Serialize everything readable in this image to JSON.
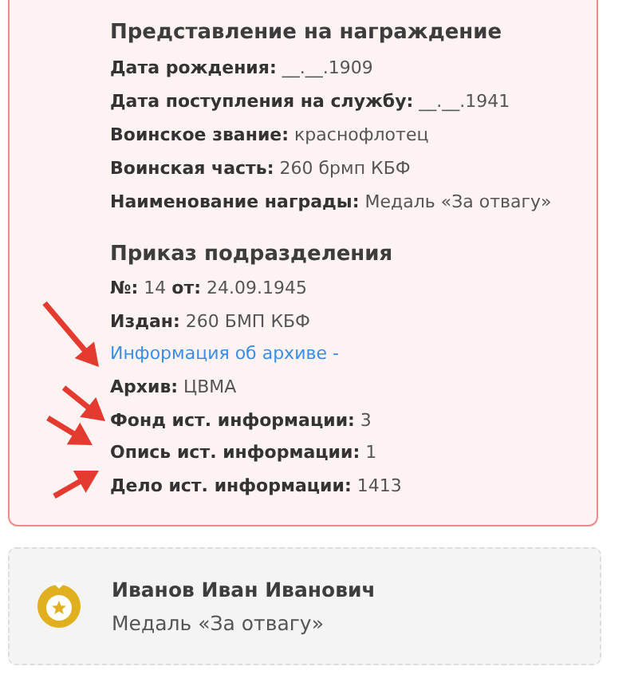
{
  "sections": [
    {
      "heading": "Представление на награждение",
      "rows": [
        {
          "kind": "text",
          "text": "**Дата рождения:** __.__.1909"
        },
        {
          "kind": "text",
          "text": "**Дата поступления на службу:** __.__.1941"
        },
        {
          "kind": "text",
          "text": "**Воинское звание:** краснофлотец"
        },
        {
          "kind": "text",
          "text": "**Воинская часть:** 260 брмп КБФ"
        },
        {
          "kind": "text",
          "text": "**Наименование награды:** Медаль «За отвагу»"
        }
      ]
    },
    {
      "heading": "Приказ подразделения",
      "rows": [
        {
          "kind": "text",
          "text": "**№:** 14 **от:** 24.09.1945"
        },
        {
          "kind": "text",
          "text": "**Издан:** 260 БМП КБФ"
        },
        {
          "kind": "link",
          "text": "Информация об архиве -"
        },
        {
          "kind": "text",
          "text": "**Архив:** ЦВМА"
        },
        {
          "kind": "text",
          "text": "**Фонд ист. информации:** 3"
        },
        {
          "kind": "text",
          "text": "**Опись ист. информации:** 1"
        },
        {
          "kind": "text",
          "text": "**Дело ист. информации:** 1413"
        }
      ]
    }
  ],
  "award_card": {
    "name": "Иванов Иван Иванович",
    "award": "Медаль «За отвагу»"
  }
}
